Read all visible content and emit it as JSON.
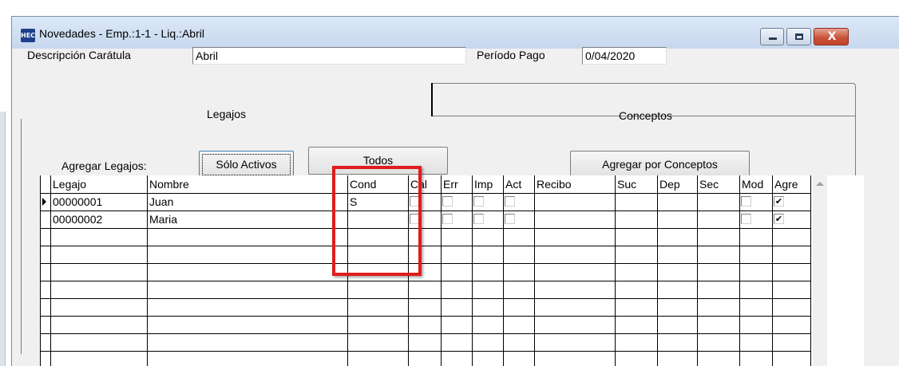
{
  "window": {
    "title": "Novedades - Emp.:1-1 - Liq.:Abril",
    "app_icon_text": "HEC",
    "close_glyph": "X"
  },
  "header": {
    "descripcion_label": "Descripción Carátula",
    "descripcion_value": "Abril",
    "periodo_label": "Período Pago",
    "periodo_value": "0/04/2020"
  },
  "tabs": [
    {
      "label": "Legajos",
      "active": true
    },
    {
      "label": "Conceptos",
      "active": false
    }
  ],
  "toolbar": {
    "agregar_label": "Agregar Legajos:",
    "solo_activos": "Sólo Activos",
    "todos": "Todos",
    "agregar_conceptos": "Agregar por Conceptos"
  },
  "grid": {
    "columns": [
      "Legajo",
      "Nombre",
      "Cond",
      "Cal",
      "Err",
      "Imp",
      "Act",
      "Recibo",
      "Suc",
      "Dep",
      "Sec",
      "Mod",
      "Agre"
    ],
    "rows": [
      {
        "legajo": "00000001",
        "nombre": "Juan",
        "cond": "S",
        "cal": false,
        "err": false,
        "imp": false,
        "act": false,
        "recibo": "",
        "suc": "",
        "dep": "",
        "sec": "",
        "mod": false,
        "agre": true,
        "current": true
      },
      {
        "legajo": "00000002",
        "nombre": "Maria",
        "cond": "",
        "cal": false,
        "err": false,
        "imp": false,
        "act": false,
        "recibo": "",
        "suc": "",
        "dep": "",
        "sec": "",
        "mod": false,
        "agre": true,
        "current": false
      }
    ],
    "check_glyph": "✔"
  },
  "annotation": {
    "highlight_color": "#e01c1c"
  }
}
